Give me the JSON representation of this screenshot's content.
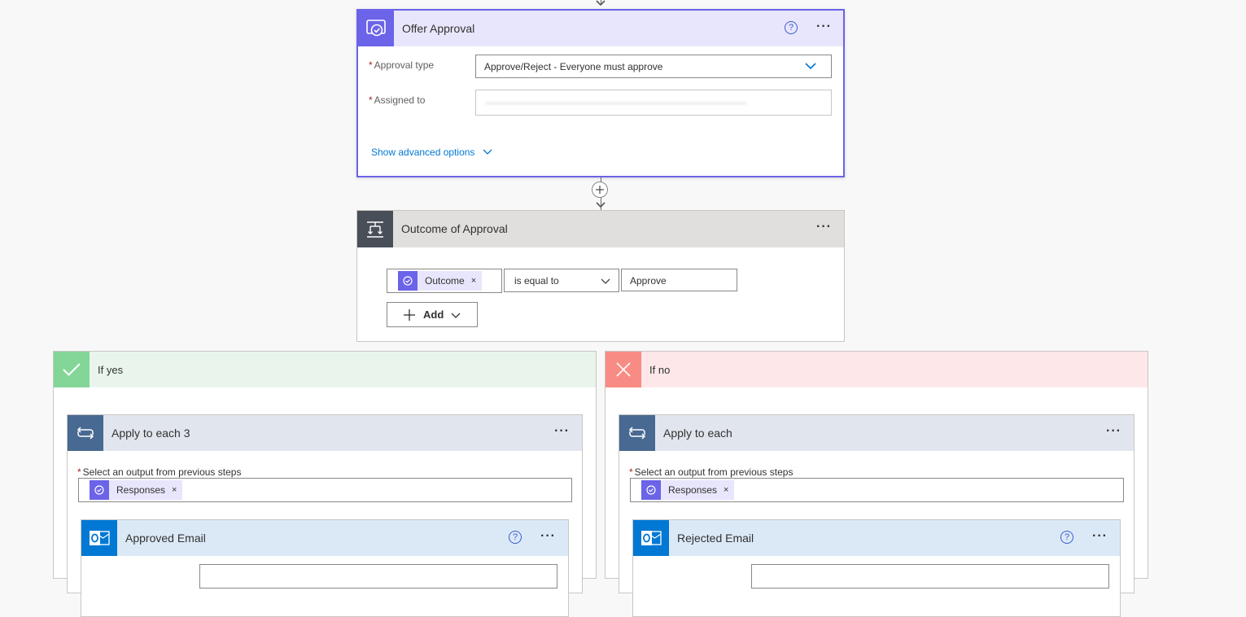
{
  "offer_approval": {
    "title": "Offer Approval",
    "approval_type_label": "Approval type",
    "approval_type_value": "Approve/Reject - Everyone must approve",
    "assigned_to_label": "Assigned to",
    "assigned_to_value": "",
    "advanced_options": "Show advanced options",
    "required_mark": "*"
  },
  "outcome_of_approval": {
    "title": "Outcome of Approval",
    "condition_token": "Outcome",
    "operator": "is equal to",
    "value": "Approve",
    "add_label": "Add"
  },
  "if_yes": {
    "title": "If yes",
    "loop_title": "Apply to each 3",
    "select_label": "Select an output from previous steps",
    "token": "Responses",
    "email_title": "Approved Email"
  },
  "if_no": {
    "title": "If no",
    "loop_title": "Apply to each",
    "select_label": "Select an output from previous steps",
    "token": "Responses",
    "email_title": "Rejected Email"
  },
  "icons": {
    "approval": "approval-icon",
    "condition": "condition-icon",
    "loop": "loop-icon",
    "outlook": "outlook-icon",
    "check": "check-icon",
    "close": "close-icon",
    "help": "help-icon",
    "more": "more-options-icon"
  },
  "colors": {
    "approval_accent": "#6b63e8",
    "approval_header": "#e8e6fc",
    "condition_header": "#e1dfdd",
    "yes_header": "#e6f4ea",
    "yes_accent": "#84d698",
    "no_header": "#fde7e9",
    "no_accent": "#f98b85",
    "loop_header": "#e0e5ee",
    "loop_accent": "#486991",
    "email_header": "#dce9f6",
    "email_accent": "#0078d4"
  },
  "symbols": {
    "help": "?",
    "more": "···",
    "close": "×"
  }
}
